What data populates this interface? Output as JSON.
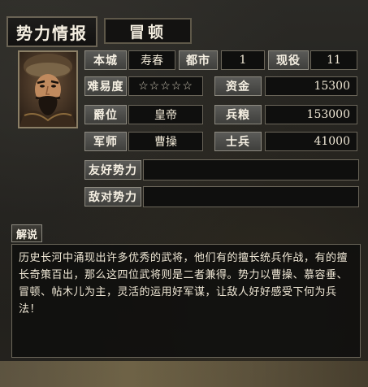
{
  "header": {
    "title": "势力情报",
    "ruler_name": "冒顿"
  },
  "stats": {
    "city_label": "本城",
    "city_value": "寿春",
    "cities_label": "都市",
    "cities_value": "1",
    "officers_label": "现役",
    "officers_value": "11",
    "difficulty_label": "难易度",
    "difficulty_stars": "☆☆☆☆☆",
    "gold_label": "资金",
    "gold_value": "15300",
    "rank_label": "爵位",
    "rank_value": "皇帝",
    "food_label": "兵粮",
    "food_value": "153000",
    "advisor_label": "军师",
    "advisor_value": "曹操",
    "troops_label": "士兵",
    "troops_value": "41000",
    "friendly_label": "友好势力",
    "friendly_value": "",
    "hostile_label": "敌对势力",
    "hostile_value": ""
  },
  "description": {
    "tab_label": "解说",
    "text": "历史长河中涌现出许多优秀的武将，他们有的擅长统兵作战，有的擅长奇策百出，那么这四位武将则是二者兼得。势力以曹操、慕容垂、冒顿、帖木儿为主，灵活的运用好军谋，让敌人好好感受下何为兵法！"
  },
  "icons": {
    "portrait": "officer-portrait"
  }
}
